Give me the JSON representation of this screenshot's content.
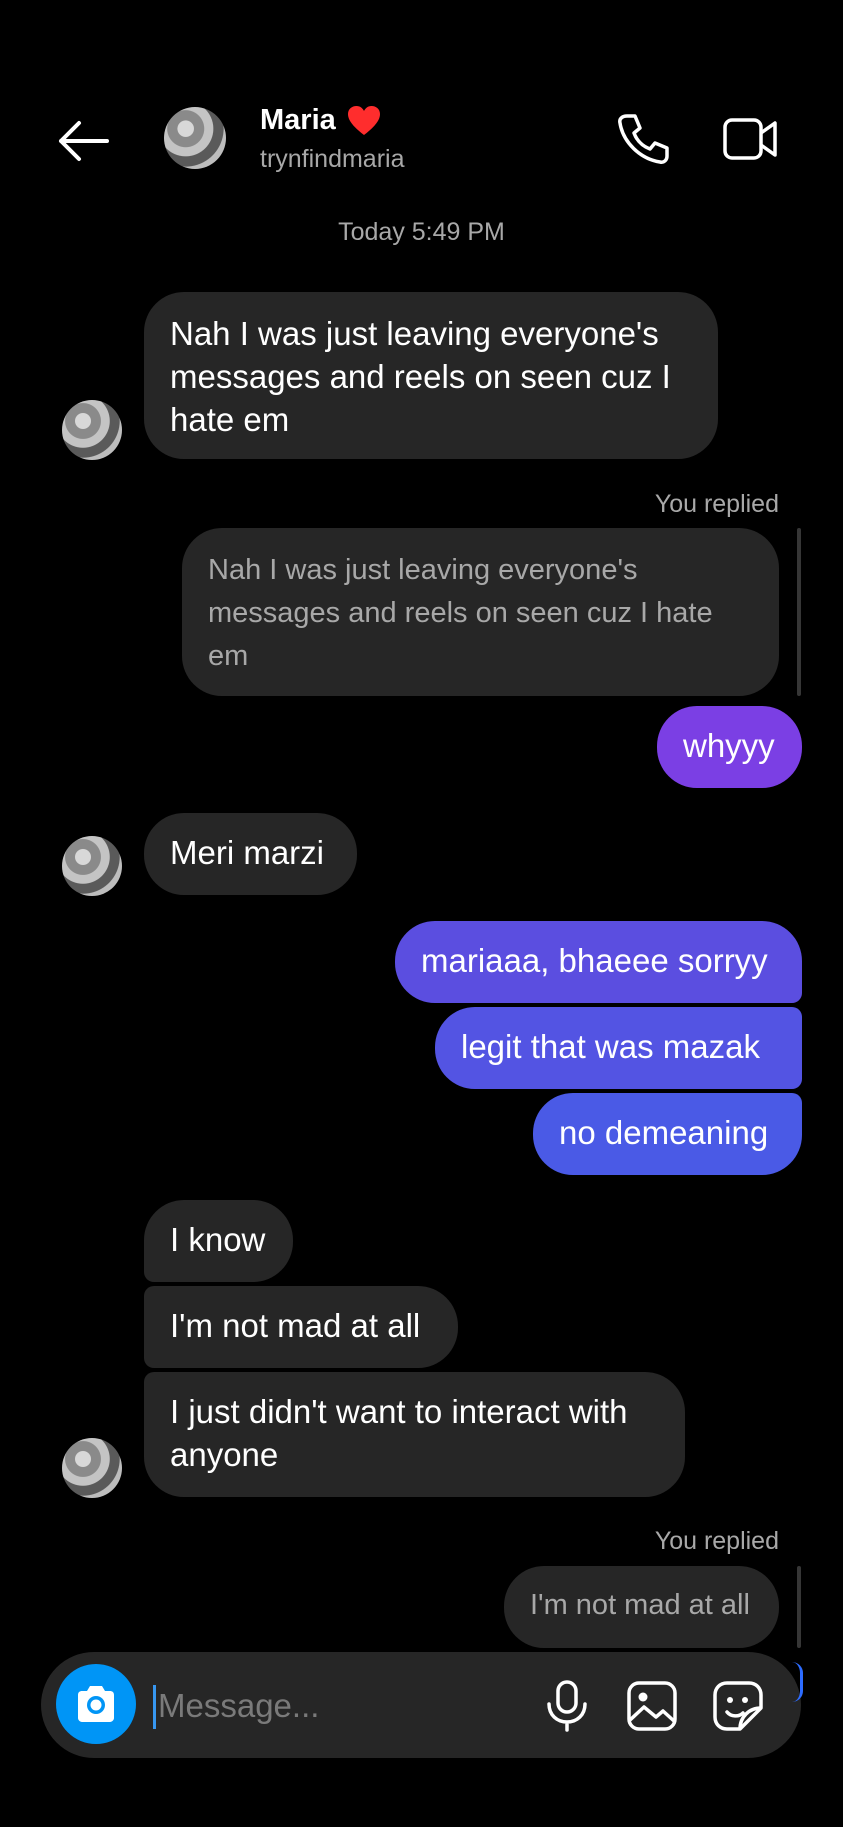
{
  "header": {
    "name": "Maria",
    "username": "trynfindmaria",
    "icons": {
      "back": "arrow-left-icon",
      "heart": "red-heart-icon",
      "call": "phone-icon",
      "video": "video-camera-icon"
    }
  },
  "timestamp": "Today 5:49 PM",
  "messages": [
    {
      "text": "Nah I was just leaving everyone's messages and reels on seen cuz I hate em"
    },
    {
      "you_replied": "You replied",
      "quote": "Nah I was just leaving everyone's messages and reels on seen cuz I hate em"
    },
    {
      "text": "whyyy"
    },
    {
      "text": "Meri marzi"
    },
    {
      "text": "mariaaa, bhaeee sorryy"
    },
    {
      "text": "legit that was mazak"
    },
    {
      "text": "no demeaning"
    },
    {
      "text": "I know"
    },
    {
      "text": "I'm not mad at all"
    },
    {
      "text": "I just didn't want to interact with anyone"
    },
    {
      "you_replied": "You replied",
      "quote": "I'm not mad at all"
    }
  ],
  "composer": {
    "placeholder": "Message...",
    "icons": [
      "camera-icon",
      "microphone-icon",
      "gallery-icon",
      "sticker-icon"
    ]
  },
  "colors": {
    "background": "#000000",
    "incoming_bubble": "#262626",
    "outgoing_purple": "#7b3fe4",
    "outgoing_indigo": "#5b4ee0",
    "outgoing_blue": "#4a5ae6",
    "accent": "#0095f6",
    "secondary_text": "#a8a8a8"
  }
}
